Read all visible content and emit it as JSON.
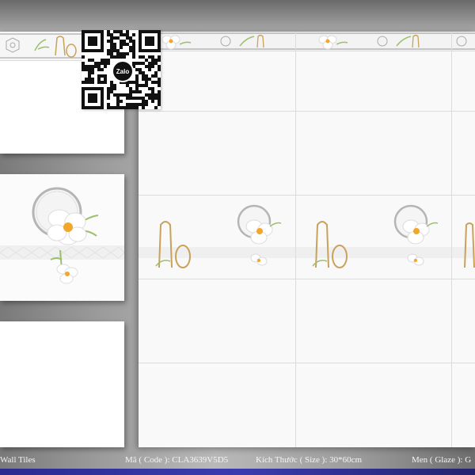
{
  "qr": {
    "logo_text": "Zalo"
  },
  "footer": {
    "category": "Wall Tiles",
    "code": "Mã ( Code ): CLA3639V5D5",
    "size": "Kích Thước ( Size ): 30*60cm",
    "glaze": "Men ( Glaze ): G"
  },
  "colors": {
    "footer_bar": "#3333a0",
    "flower_center": "#f2a62a",
    "gold_accent": "#c9a25a",
    "leaf": "#9cbf6e"
  },
  "icons": [
    "qr-code-icon",
    "zalo-logo-icon",
    "flower-motif-icon",
    "mirror-frame-icon",
    "vase-motif-icon"
  ]
}
